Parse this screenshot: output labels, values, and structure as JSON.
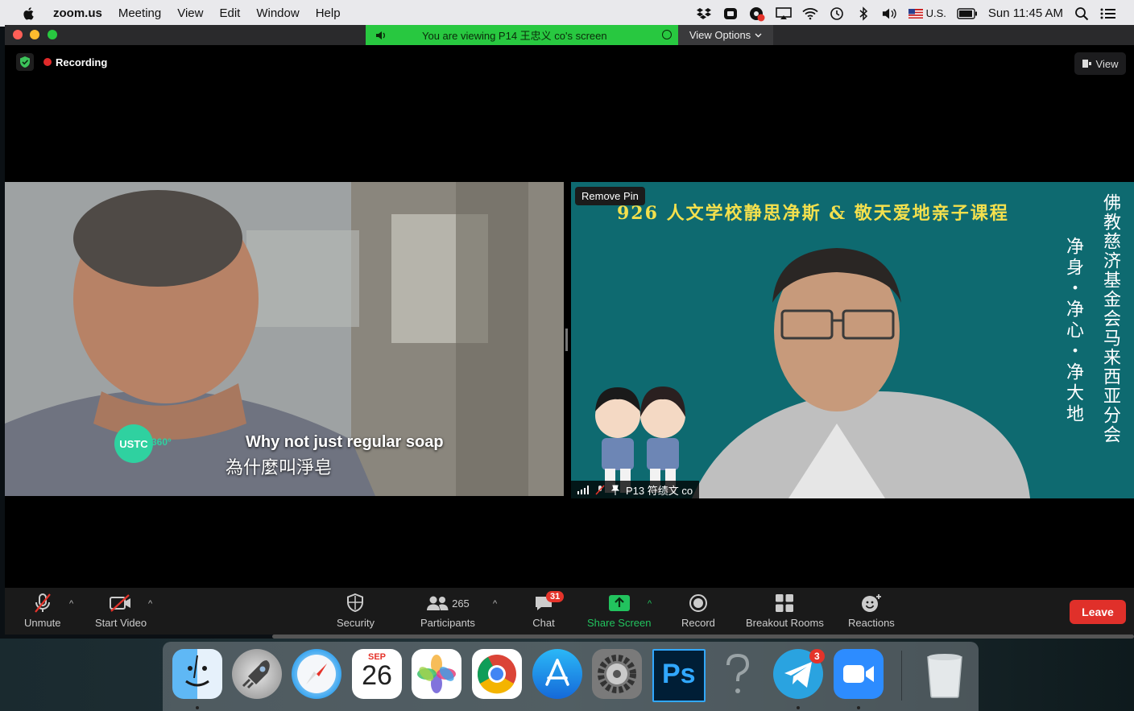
{
  "menubar": {
    "app_name": "zoom.us",
    "menus": [
      "Meeting",
      "View",
      "Edit",
      "Window",
      "Help"
    ],
    "input_source": "U.S.",
    "clock": "Sun 11:45 AM"
  },
  "share_banner": {
    "text": "You are viewing P14 王忠义 co's screen",
    "view_options": "View Options"
  },
  "meeting": {
    "recording_label": "Recording",
    "view_label": "View"
  },
  "left_tile": {
    "subtitle_en": "Why not just regular soap",
    "subtitle_zh": "為什麼叫淨皂",
    "logo_text": "USTC",
    "logo_suffix": "360°"
  },
  "right_tile": {
    "remove_pin": "Remove Pin",
    "course_title": "926 人文学校静思净斯 & 敬天爱地亲子课程",
    "vertical_left": "净身・净心・净大地",
    "vertical_right": "佛教慈济基金会马来西亚分会",
    "participant_name": "P13 符绩文 co"
  },
  "toolbar": {
    "unmute": "Unmute",
    "start_video": "Start Video",
    "security": "Security",
    "participants": "Participants",
    "participants_count": "265",
    "chat": "Chat",
    "chat_badge": "31",
    "share_screen": "Share Screen",
    "record": "Record",
    "breakout_rooms": "Breakout Rooms",
    "reactions": "Reactions",
    "leave": "Leave"
  },
  "dock": {
    "calendar_month": "SEP",
    "calendar_day": "26",
    "telegram_badge": "3",
    "photoshop_label": "Ps"
  },
  "colors": {
    "share_green": "#28c840",
    "leave_red": "#e0302a",
    "share_icon_green": "#22c35e",
    "course_yellow": "#f4e04d",
    "teal_bg": "#0e6a70"
  }
}
